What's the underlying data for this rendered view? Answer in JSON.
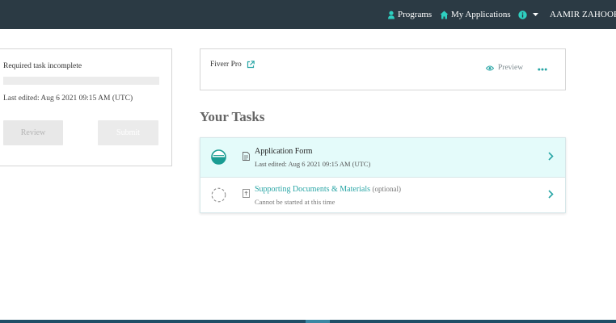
{
  "topbar": {
    "programs_label": "Programs",
    "my_applications_label": "My Applications",
    "user_name": "AAMIR ZAHOOR",
    "bg_color": "#2b3a44",
    "accent_color": "#2ecfc0"
  },
  "status_panel": {
    "message": "Required task incomplete",
    "progress": 0,
    "last_edited": "Last edited: Aug 6 2021 09:15 AM (UTC)",
    "review_label": "Review",
    "submit_label": "Submit"
  },
  "program_card": {
    "title": "Fiverr Pro",
    "preview_label": "Preview",
    "more_icon": "more-dots-icon"
  },
  "tasks": {
    "heading": "Your Tasks",
    "items": [
      {
        "name": "Application Form",
        "subtitle": "Last edited: Aug 6 2021 09:15 AM (UTC)",
        "status_icon": "half-complete-icon",
        "doc_icon": "document-icon"
      },
      {
        "name": "Supporting Documents & Materials",
        "optional_label": "(optional)",
        "subtitle": "Cannot be started at this time",
        "status_icon": "not-started-icon",
        "doc_icon": "upload-icon"
      }
    ]
  }
}
